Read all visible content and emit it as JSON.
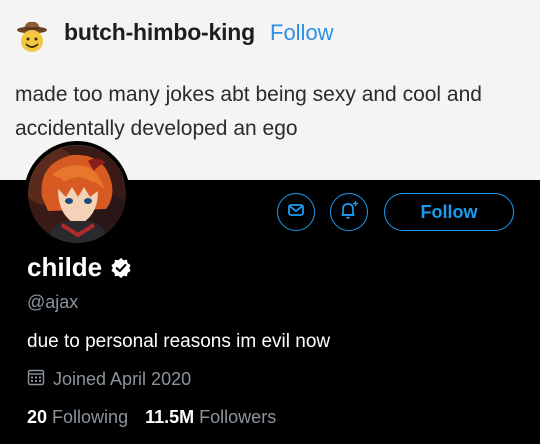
{
  "post": {
    "username": "butch-himbo-king",
    "follow_label": "Follow",
    "text": "made too many jokes abt being sexy and cool and accidentally developed an ego"
  },
  "profile": {
    "display_name": "childe",
    "handle": "@ajax",
    "bio": "due to personal reasons im evil now",
    "joined": "Joined April 2020",
    "following_count": "20",
    "following_label": "Following",
    "followers_count": "11.5M",
    "followers_label": "Followers",
    "follow_label": "Follow"
  },
  "icons": {
    "message": "envelope-icon",
    "notify": "bell-plus-icon",
    "verified": "verified-badge-icon",
    "calendar": "calendar-icon"
  },
  "colors": {
    "accent": "#1d9bf0",
    "tumblr_link": "#2f8fe3",
    "muted": "#8b949b"
  }
}
